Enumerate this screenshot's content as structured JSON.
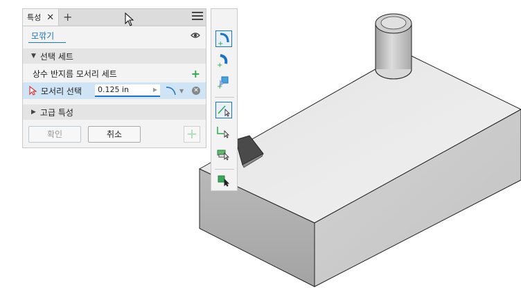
{
  "panel": {
    "tab_label": "특성",
    "tab_close": "✕",
    "tab_add": "+",
    "preset": "모깎기",
    "section_select": "선택 세트",
    "constant_radius_set": "상수 반지름 모서리 세트",
    "edge_select_label": "모서리 선택",
    "edge_radius_value": "0.125 in",
    "section_advanced": "고급 특성",
    "ok_button": "확인",
    "cancel_button": "취소"
  },
  "palette": {
    "icons": [
      "constant-fillet-icon",
      "variable-fillet-icon",
      "setback-fillet-icon",
      "edge-select-mode-icon",
      "loop-select-mode-icon",
      "feature-select-mode-icon",
      "solid-select-mode-icon"
    ]
  },
  "colors": {
    "accent": "#1a73c8",
    "green": "#2ea84a",
    "selection_row": "#cfe5f6"
  }
}
